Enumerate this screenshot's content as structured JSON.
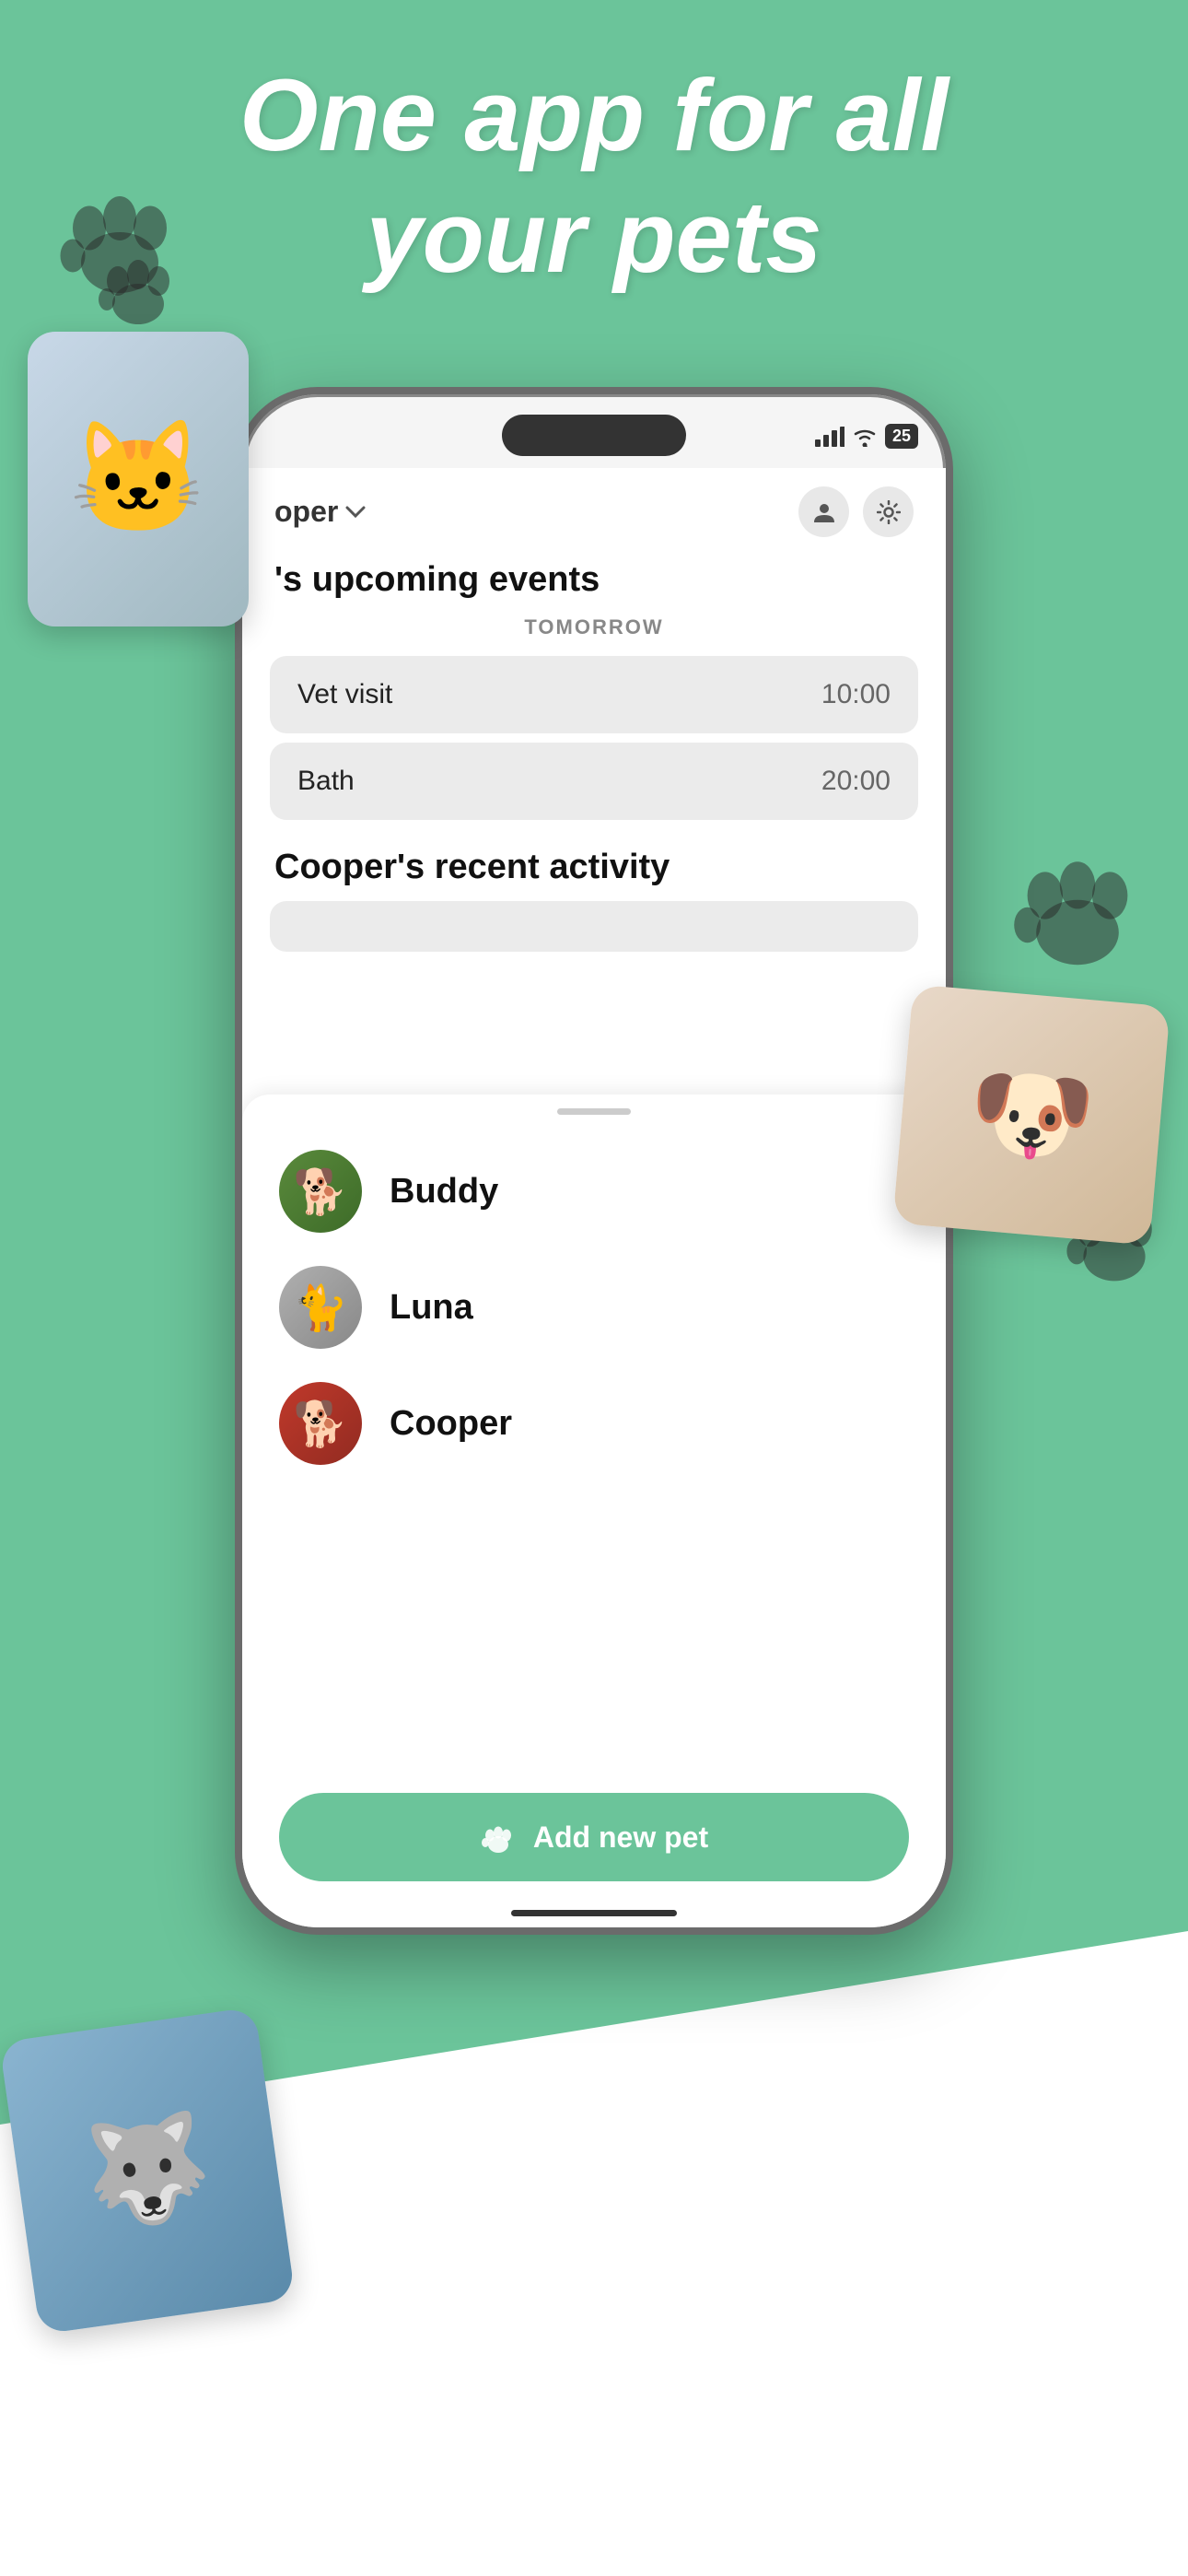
{
  "hero": {
    "line1": "One app for all",
    "line2": "your pets"
  },
  "phone": {
    "status": {
      "battery": "25",
      "wifi": "wifi",
      "signal": "signal"
    },
    "header": {
      "pet_name": "Cooper",
      "dropdown_label": "oper",
      "contacts_icon": "contacts",
      "settings_icon": "settings"
    },
    "upcoming": {
      "section_title": "'s upcoming events",
      "date_label": "TOMORROW",
      "events": [
        {
          "name": "Vet visit",
          "time": "10:00"
        },
        {
          "name": "Bath",
          "time": "20:00"
        }
      ]
    },
    "recent": {
      "section_title": "Cooper's recent activity"
    },
    "pets": [
      {
        "name": "Buddy",
        "avatar_type": "buddy",
        "emoji": "🐕"
      },
      {
        "name": "Luna",
        "avatar_type": "luna",
        "emoji": "🐈"
      },
      {
        "name": "Cooper",
        "avatar_type": "cooper",
        "emoji": "🐕"
      }
    ],
    "add_pet": {
      "label": "Add new pet",
      "icon": "paw"
    }
  }
}
